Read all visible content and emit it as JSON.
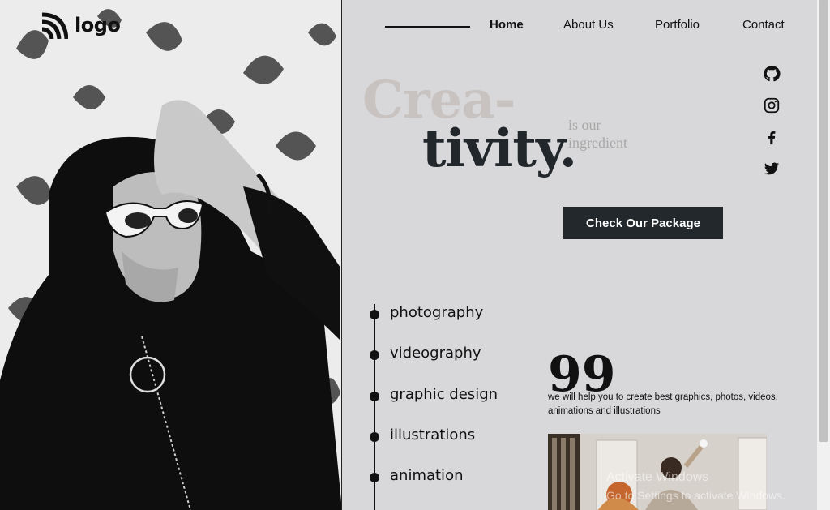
{
  "brand": {
    "logo_text": "logo",
    "logo_icon": "rss-wave-icon"
  },
  "nav": {
    "items": [
      {
        "label": "Home",
        "active": true
      },
      {
        "label": "About Us",
        "active": false
      },
      {
        "label": "Portfolio",
        "active": false
      },
      {
        "label": "Contact",
        "active": false
      }
    ]
  },
  "socials": [
    "github-icon",
    "instagram-icon",
    "facebook-icon",
    "twitter-icon"
  ],
  "hero": {
    "line1": "Crea-",
    "line2": "tivity.",
    "subtitle": "is our ingredient",
    "cta_label": "Check Our Package"
  },
  "services": [
    "photography",
    "videography",
    "graphic design",
    "illustrations",
    "animation"
  ],
  "quote": {
    "mark": "99",
    "text": "we will help you to create best graphics, photos, videos, animations and illustrations"
  },
  "os_watermark": {
    "title": "Activate Windows",
    "subtitle": "Go to Settings to activate Windows."
  },
  "colors": {
    "background": "#d8d8da",
    "dark": "#22282c",
    "hero_light": "#c8c3c0",
    "subtitle_grey": "#a9a7a6"
  }
}
